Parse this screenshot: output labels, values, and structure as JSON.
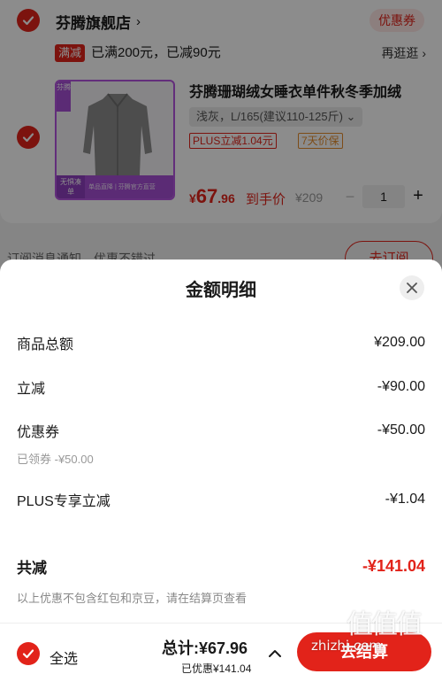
{
  "cart": {
    "store": {
      "name": "芬腾旗舰店",
      "chevron": "›",
      "coupon_tag": "优惠券",
      "promo_badge": "满减",
      "promo_text": "已满200元，已减90元",
      "promo_link": "再逛逛 ›"
    },
    "item": {
      "thumb_top_badge": "芬腾",
      "thumb_bottom_left": "无惧凑单",
      "thumb_bottom_text": "单品直降 | 芬腾官方直营",
      "title": "芬腾珊瑚绒女睡衣单件秋冬季加绒",
      "spec": "浅灰，L/165(建议110-125斤) ⌄",
      "tag_plus": "PLUS立减1.04元",
      "tag_return": "7天价保",
      "price_currency": "¥",
      "price_int": "67",
      "price_dec": ".96",
      "price_label": "到手价",
      "original_price": "¥209",
      "qty_minus": "−",
      "quantity": "1",
      "qty_plus": "+"
    },
    "subscribe": {
      "text": "订阅消息通知，优惠不错过",
      "button": "去订阅"
    }
  },
  "sheet": {
    "title": "金额明细",
    "rows": [
      {
        "label": "商品总额",
        "amount": "¥209.00"
      },
      {
        "label": "立减",
        "amount": "-¥90.00"
      },
      {
        "label": "优惠券",
        "amount": "-¥50.00",
        "note": "已领券 -¥50.00"
      },
      {
        "label": "PLUS专享立减",
        "amount": "-¥1.04"
      }
    ],
    "total": {
      "label": "共减",
      "amount": "-¥141.04"
    },
    "disclaimer": "以上优惠不包含红包和京豆，请在结算页查看"
  },
  "footer": {
    "select_all": "全选",
    "total": "总计:¥67.96",
    "saved": "已优惠¥141.04",
    "checkout": "去结算"
  },
  "watermark": {
    "logo": "值值值",
    "url": "zhizhi.com"
  },
  "colors": {
    "accent": "#e2231a",
    "purple_frame": "#b455e0",
    "orange_tag": "#e38a2b"
  }
}
